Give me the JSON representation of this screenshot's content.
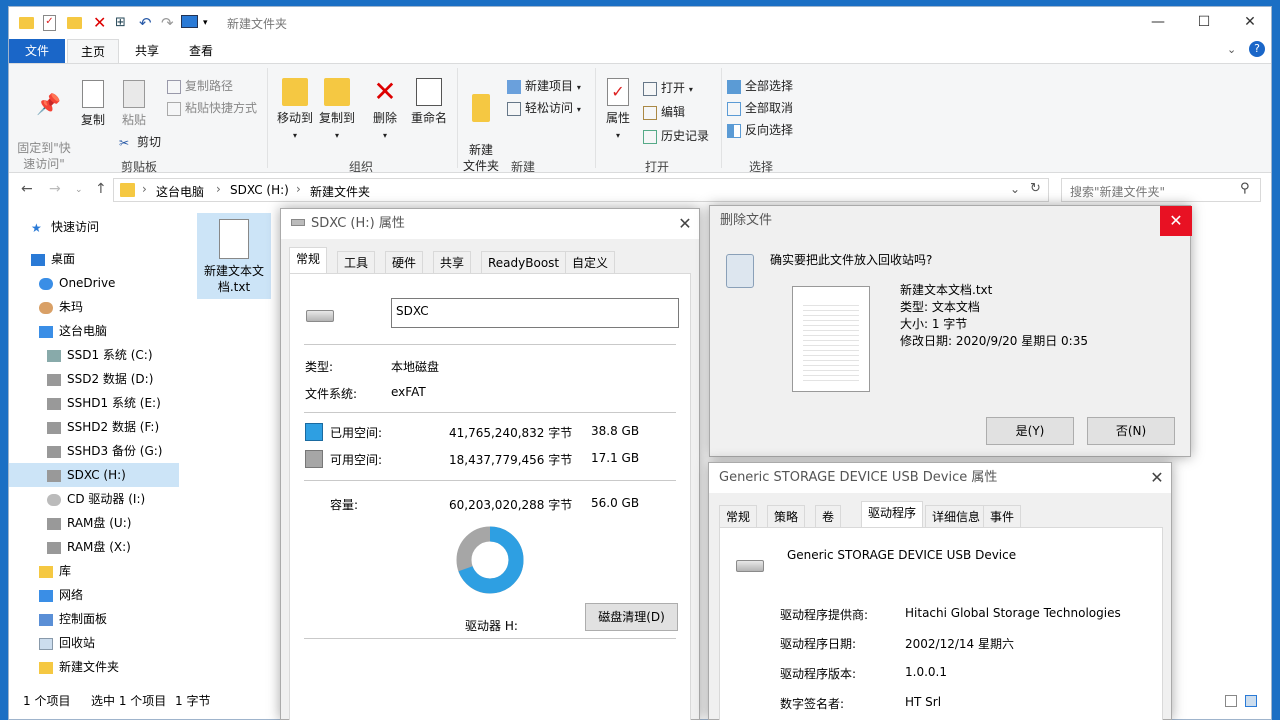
{
  "explorer": {
    "title": "新建文件夹",
    "ribbon_tabs": [
      "文件",
      "主页",
      "共享",
      "查看"
    ],
    "clipboard": {
      "pin": "固定到\"快\n速访问\"",
      "copy": "复制",
      "paste": "粘贴",
      "copy_path": "复制路径",
      "paste_shortcut": "粘贴快捷方式",
      "cut": "剪切",
      "group": "剪贴板"
    },
    "organize": {
      "move_to": "移动到",
      "copy_to": "复制到",
      "delete": "删除",
      "rename": "重命名",
      "group": "组织"
    },
    "new": {
      "new_folder": "新建\n文件夹",
      "new_item": "新建项目",
      "easy_access": "轻松访问",
      "group": "新建"
    },
    "open": {
      "properties": "属性",
      "open": "打开",
      "edit": "编辑",
      "history": "历史记录",
      "group": "打开"
    },
    "select": {
      "select_all": "全部选择",
      "select_none": "全部取消",
      "invert": "反向选择",
      "group": "选择"
    },
    "breadcrumb": [
      "这台电脑",
      "SDXC (H:)",
      "新建文件夹"
    ],
    "search_placeholder": "搜索\"新建文件夹\"",
    "nav": [
      "快速访问",
      "桌面",
      "OneDrive",
      "朱玛",
      "这台电脑",
      "SSD1 系统 (C:)",
      "SSD2 数据 (D:)",
      "SSHD1 系统 (E:)",
      "SSHD2 数据 (F:)",
      "SSHD3 备份 (G:)",
      "SDXC (H:)",
      "CD 驱动器 (I:)",
      "RAM盘 (U:)",
      "RAM盘 (X:)",
      "库",
      "网络",
      "控制面板",
      "回收站",
      "新建文件夹"
    ],
    "file_name": "新建文本文\n档.txt",
    "status": {
      "count": "1 个项目",
      "selected": "选中 1 个项目",
      "size": "1 字节"
    }
  },
  "props": {
    "title": "SDXC (H:) 属性",
    "tabs": [
      "常规",
      "工具",
      "硬件",
      "共享",
      "ReadyBoost",
      "自定义"
    ],
    "name_value": "SDXC",
    "type_label": "类型:",
    "type_value": "本地磁盘",
    "fs_label": "文件系统:",
    "fs_value": "exFAT",
    "used_label": "已用空间:",
    "used_bytes": "41,765,240,832 字节",
    "used_gb": "38.8 GB",
    "free_label": "可用空间:",
    "free_bytes": "18,437,779,456 字节",
    "free_gb": "17.1 GB",
    "cap_label": "容量:",
    "cap_bytes": "60,203,020,288 字节",
    "cap_gb": "56.0 GB",
    "drive_label": "驱动器 H:",
    "cleanup_btn": "磁盘清理(D)",
    "used_fraction": 0.694,
    "used_color": "#2e9fe2",
    "free_color": "#a6a6a6"
  },
  "delete_dialog": {
    "title": "删除文件",
    "question": "确实要把此文件放入回收站吗?",
    "file_name": "新建文本文档.txt",
    "type": "类型: 文本文档",
    "size": "大小: 1 字节",
    "modified": "修改日期: 2020/9/20 星期日 0:35",
    "yes": "是(Y)",
    "no": "否(N)"
  },
  "device_dialog": {
    "title": "Generic STORAGE DEVICE USB Device 属性",
    "tabs": [
      "常规",
      "策略",
      "卷",
      "驱动程序",
      "详细信息",
      "事件"
    ],
    "device_name": "Generic STORAGE DEVICE USB Device",
    "provider_label": "驱动程序提供商:",
    "provider_value": "Hitachi Global Storage Technologies",
    "date_label": "驱动程序日期:",
    "date_value": "2002/12/14 星期六",
    "version_label": "驱动程序版本:",
    "version_value": "1.0.0.1",
    "signer_label": "数字签名者:",
    "signer_value": "HT Srl"
  }
}
